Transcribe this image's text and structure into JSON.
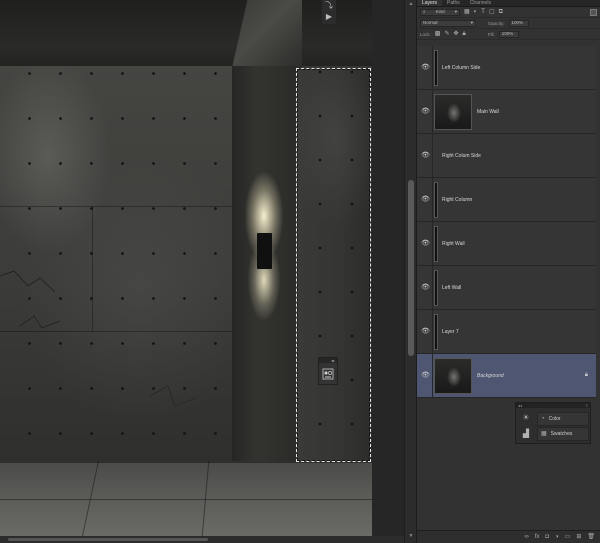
{
  "panel": {
    "tabs": [
      "Layers",
      "Paths",
      "Channels"
    ],
    "filter_kind": "Kind",
    "blend_mode": "Normal",
    "opacity_label": "Opacity:",
    "opacity_value": "100%",
    "lock_label": "Lock:",
    "fill_label": "Fill:",
    "fill_value": "100%"
  },
  "layers": [
    {
      "name": "Left Column Side",
      "thumb": "narrow",
      "selected": false,
      "locked": false
    },
    {
      "name": "Main Wall",
      "thumb": "wide",
      "selected": false,
      "locked": false
    },
    {
      "name": "Right Colum Side",
      "thumb": "none",
      "selected": false,
      "locked": false
    },
    {
      "name": "Right Column",
      "thumb": "narrow",
      "selected": false,
      "locked": false
    },
    {
      "name": "Right Wall",
      "thumb": "narrow",
      "selected": false,
      "locked": false
    },
    {
      "name": "Left Wall",
      "thumb": "narrow",
      "selected": false,
      "locked": false
    },
    {
      "name": "Layer 7",
      "thumb": "narrow",
      "selected": false,
      "locked": false
    },
    {
      "name": "Background",
      "thumb": "wide",
      "selected": true,
      "locked": true
    }
  ],
  "dock": {
    "items": [
      "Color",
      "Swatches"
    ]
  },
  "colors": {
    "selection_row": "#4e5671",
    "panel_bg": "#323232"
  }
}
